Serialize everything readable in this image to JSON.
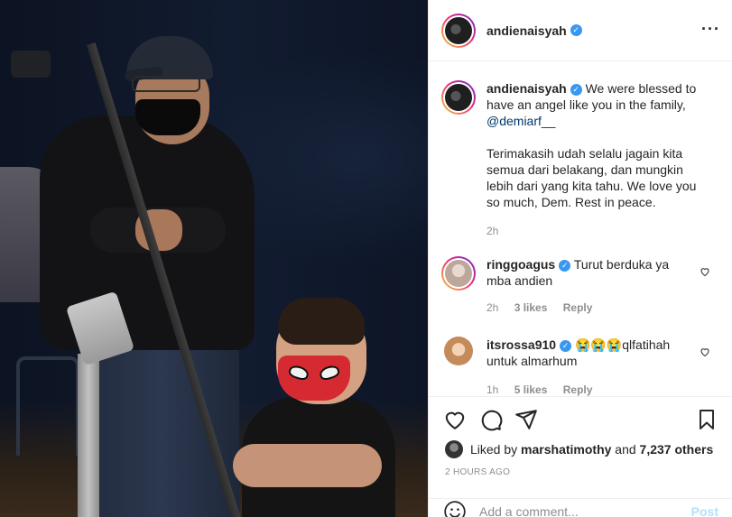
{
  "post": {
    "author": "andienaisyah",
    "verified": true,
    "more_icon": "more-horizontal-icon"
  },
  "caption": {
    "username": "andienaisyah",
    "line1": "We were blessed to have an angel like you in the family,",
    "mention": "@demiarf__",
    "paragraph2": "Terimakasih udah selalu jagain kita semua dari belakang, dan mungkin lebih dari yang kita tahu. We love you so much, Dem. Rest in peace.",
    "time": "2h"
  },
  "comments": [
    {
      "username": "ringgoagus",
      "verified": true,
      "text": "Turut berduka ya mba andien",
      "time": "2h",
      "likes": "3 likes",
      "reply": "Reply"
    },
    {
      "username": "itsrossa910",
      "verified": true,
      "emoji": "😭😭😭",
      "text": "qlfatihah untuk almarhum",
      "time": "1h",
      "likes": "5 likes",
      "reply": "Reply"
    }
  ],
  "likes": {
    "prefix": "Liked by",
    "user": "marshatimothy",
    "joiner": "and",
    "others": "7,237 others"
  },
  "timestamp": "2 HOURS AGO",
  "add_comment": {
    "placeholder": "Add a comment...",
    "post_label": "Post"
  },
  "colors": {
    "verified": "#3897f0",
    "mention": "#00376b",
    "post_disabled": "#b2dffc",
    "muted": "#8e8e8e"
  }
}
